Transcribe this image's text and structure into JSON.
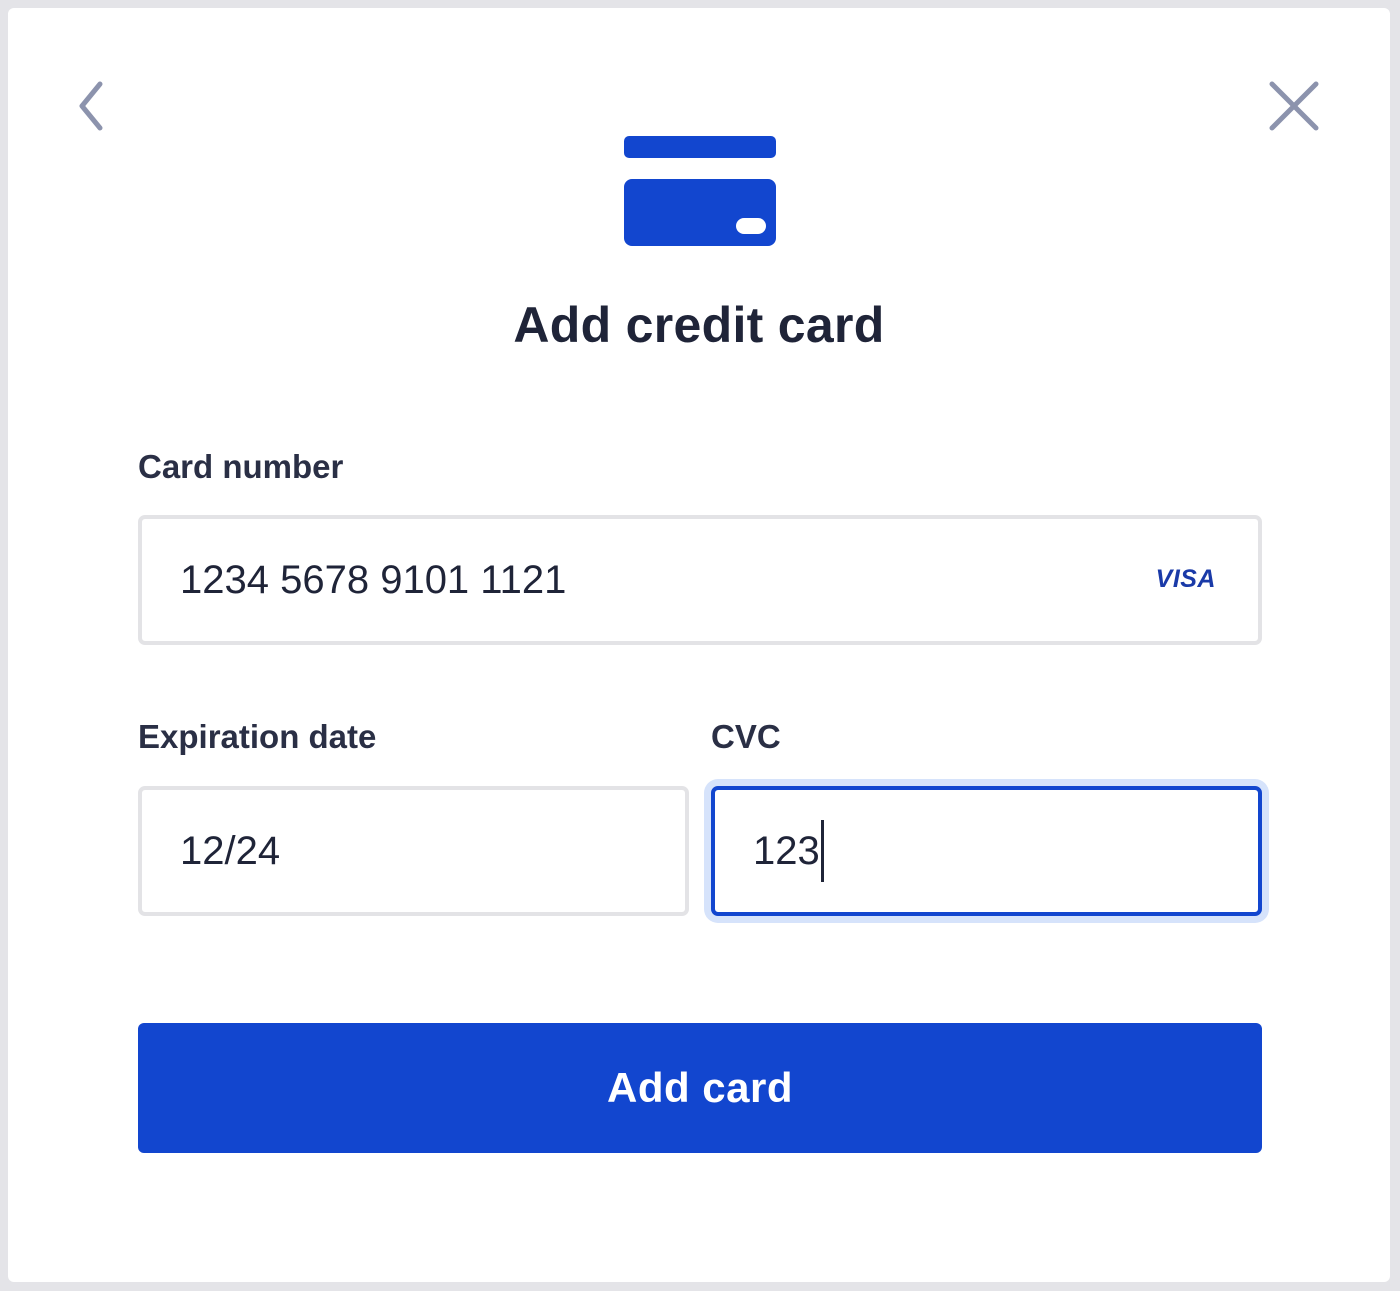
{
  "dialog": {
    "title": "Add credit card"
  },
  "nav": {
    "back_icon": "chevron-left-icon",
    "close_icon": "close-icon"
  },
  "fields": {
    "card_number": {
      "label": "Card number",
      "value": "1234 5678 9101 1121",
      "brand": "VISA"
    },
    "expiration": {
      "label": "Expiration date",
      "value": "12/24"
    },
    "cvc": {
      "label": "CVC",
      "value": "123",
      "focused": true
    }
  },
  "submit": {
    "label": "Add card"
  },
  "colors": {
    "accent": "#1246cf",
    "text": "#1f2438",
    "icon_muted": "#8c93ad",
    "border": "#e3e3e6",
    "focus_ring": "#d6e3fb"
  }
}
